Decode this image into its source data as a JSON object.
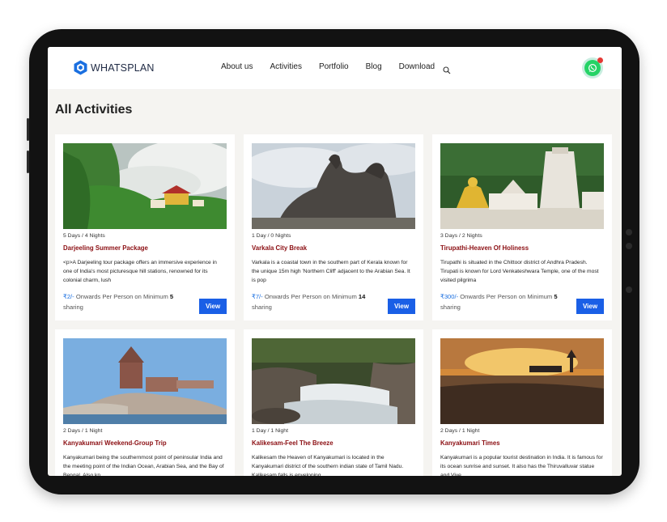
{
  "brand": {
    "name": "WHATSPLAN"
  },
  "nav": {
    "items": [
      "About us",
      "Activities",
      "Portfolio",
      "Blog",
      "Download"
    ]
  },
  "page": {
    "title": "All Activities"
  },
  "colors": {
    "accent": "#1a5fe6",
    "title_red": "#8b0e12",
    "whatsapp": "#25d366",
    "price_blue": "#1a6fe0"
  },
  "icons": {
    "search": "search-icon",
    "whatsapp": "whatsapp-icon",
    "logo": "hexagon-logo-icon"
  },
  "cards": [
    {
      "duration": "5 Days / 4 Nights",
      "title": "Darjeeling Summer Package",
      "desc": "<p>A Darjeeling tour package offers an immersive experience in one of India's most picturesque hill stations, renowned for its colonial charm, lush",
      "price": "₹2/-",
      "price_text": "Onwards Per Person on Minimum",
      "min": "5",
      "sharing": "sharing",
      "view": "View"
    },
    {
      "duration": "1 Day / 0 Nights",
      "title": "Varkala City Break",
      "desc": "Varkala is a coastal town in the southern part of Kerala known for the unique 15m high 'Northern Cliff' adjacent to the Arabian Sea. It is pop",
      "price": "₹7/-",
      "price_text": "Onwards Per Person on Minimum",
      "min": "14",
      "sharing": "sharing",
      "view": "View"
    },
    {
      "duration": "3 Days / 2 Nights",
      "title": "Tirupathi-Heaven Of Holiness",
      "desc": "Tirupathi is situated in the Chittoor district of Andhra Pradesh. Tirupati is known for Lord Venkateshwara Temple, one of the most visited pilgrima",
      "price": "₹300/-",
      "price_text": "Onwards Per Person on Minimum",
      "min": "5",
      "sharing": "sharing",
      "view": "View"
    },
    {
      "duration": "2 Days / 1 Night",
      "title": "Kanyakumari Weekend-Group Trip",
      "desc": "Kanyakumari being the southernmost point of peninsular India and the meeting point of the Indian Ocean, Arabian Sea, and the Bay of Bengal. Also kn",
      "price": "",
      "price_text": "",
      "min": "",
      "sharing": "",
      "view": ""
    },
    {
      "duration": "1 Day / 1 Night",
      "title": "Kalikesam-Feel The Breeze",
      "desc": "Kalikesam the Heaven of Kanyakumari is located in the Kanyakumari district of the southern indian state of Tamil Nadu. Kalikesam falls is enveloping",
      "price": "",
      "price_text": "",
      "min": "",
      "sharing": "",
      "view": ""
    },
    {
      "duration": "2 Days / 1 Night",
      "title": "Kanyakumari Times",
      "desc": "Kanyakumari is a popular tourist destination in India. It is famous for its ocean sunrise and sunset. It also has the Thiruvalluvar statue and Vive",
      "price": "",
      "price_text": "",
      "min": "",
      "sharing": "",
      "view": ""
    }
  ]
}
